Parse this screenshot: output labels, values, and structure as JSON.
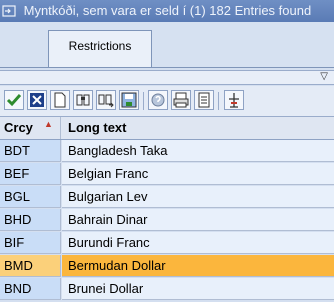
{
  "window": {
    "title": "Myntkóði, sem vara er seld í (1)  182 Entries found"
  },
  "tabs": [
    {
      "label": "Restrictions"
    }
  ],
  "toolbar": {
    "buttons": [
      "check-icon",
      "cancel-icon",
      "new-document-icon",
      "find-icon",
      "find-next-icon",
      "save-icon",
      "help-icon",
      "print-icon",
      "list-icon",
      "sort-icon"
    ]
  },
  "table": {
    "columns": [
      "Crcy",
      "Long text"
    ],
    "rows": [
      {
        "code": "BDT",
        "text": "Bangladesh Taka",
        "selected": false
      },
      {
        "code": "BEF",
        "text": "Belgian Franc",
        "selected": false
      },
      {
        "code": "BGL",
        "text": "Bulgarian Lev",
        "selected": false
      },
      {
        "code": "BHD",
        "text": "Bahrain Dinar",
        "selected": false
      },
      {
        "code": "BIF",
        "text": "Burundi Franc",
        "selected": false
      },
      {
        "code": "BMD",
        "text": "Bermudan Dollar",
        "selected": true
      },
      {
        "code": "BND",
        "text": "Brunei Dollar",
        "selected": false
      }
    ]
  },
  "colors": {
    "selected_row": "#fbb63d",
    "title_bar": "#5a7bb5"
  }
}
